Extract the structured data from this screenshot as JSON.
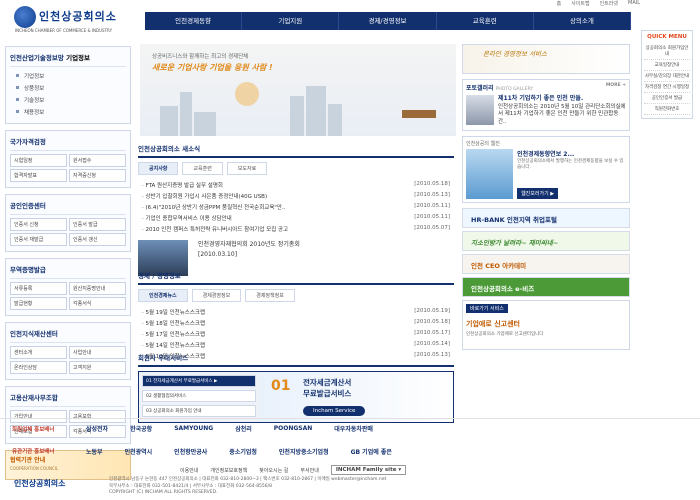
{
  "top_util": [
    "홈",
    "사이트맵",
    "인트라넷",
    "MAIL"
  ],
  "logo": {
    "name": "인천상공회의소",
    "eng": "INCHEON CHAMBER OF COMMERCE & INDUSTRY"
  },
  "gnb": [
    "인천경제동향",
    "기업지원",
    "경제/경영정보",
    "교육훈련",
    "상의소개"
  ],
  "left": {
    "info": {
      "title": "인천산업기술정보망",
      "bold": "기업정보",
      "items": [
        "기업정보",
        "상품정보",
        "기술정보",
        "채용정보"
      ]
    },
    "certificate": {
      "title": "국가자격검정",
      "items": [
        "시험일정",
        "원서접수",
        "합격자발표",
        "자격증신청"
      ]
    },
    "cert_issue": {
      "title": "공인인증센터",
      "items": [
        "인증서 신청",
        "인증서 발급",
        "인증서 재발급",
        "인증서 갱신"
      ]
    },
    "trade": {
      "title": "무역증명발급",
      "items": [
        "서류등록",
        "원산지증명안내",
        "발급현황",
        "각종서식"
      ]
    },
    "ip": {
      "title": "인천지식재산센터",
      "items": [
        "센터소개",
        "사업안내",
        "온라인상담",
        "고객지원"
      ]
    },
    "arbitration": {
      "title": "고용산재사무조합",
      "items": [
        "가입안내",
        "고용보험",
        "산재보험",
        "각종서식"
      ]
    },
    "banner": {
      "main": "협력기관 안내",
      "sub": "COOPERATION COUNCIL"
    }
  },
  "hero": {
    "t1": "상공비즈니스와 함께하는 최고의 경제단체",
    "t2": "새로운 기업사랑 기업을 응원 사람 !"
  },
  "news": {
    "title": "인천상공회의소 새소식",
    "tabs": [
      "공지사항",
      "교육훈련",
      "보도자료"
    ],
    "rows": [
      {
        "title": "FTA 원산지증명 발급 실무 설명회",
        "date": "[2010.05.18]"
      },
      {
        "title": "상반기 입찰회원 가입시 사은품 증정안내(40G USB)",
        "date": "[2010.05.13]"
      },
      {
        "title": "(6.4)\"2010년 상반기 성금PPM 품질혁신 전국순회교육\"안..",
        "date": "[2010.05.11]"
      },
      {
        "title": "기업인 종합무역서비스 이용 상담안내",
        "date": "[2010.05.11]"
      },
      {
        "title": "2010 인천 캠퍼스 특허전략 유니버시아드 참여기업 모집 공고",
        "date": "[2010.05.07]"
      }
    ],
    "photo_title": "인천경영자재협의회 2010년도 정기총회",
    "photo_date": "[2010.03.10]"
  },
  "econ": {
    "title": "경제 / 경영정보",
    "tabs": [
      "인천경제뉴스",
      "경제경영정보",
      "경제정책정보"
    ],
    "rows": [
      {
        "title": "5월 19일 인천뉴스스크랩",
        "date": "[2010.05.19]"
      },
      {
        "title": "5월 18일 인천뉴스스크랩",
        "date": "[2010.05.18]"
      },
      {
        "title": "5월 17일 인천뉴스스크랩",
        "date": "[2010.05.17]"
      },
      {
        "title": "5월 14일 인천뉴스스크랩",
        "date": "[2010.05.14]"
      },
      {
        "title": "5월 13일 인천뉴스스크랩",
        "date": "[2010.05.13]"
      }
    ]
  },
  "service": {
    "title": "회원사 부대서비스",
    "list": [
      "01 전자세금계산서 무료발급서비스 ▶",
      "02 생활협업의서비스",
      "03 상공회의소 회원가입 안내"
    ],
    "num": "01",
    "line1": "전자세금계산서",
    "line2": "무료발급서비스",
    "btn": "Incham Service"
  },
  "right": {
    "banner1": "온라인 경영정보 서비스",
    "gallery": {
      "title": "포토갤러리",
      "sub": "PHOTO GALLERY",
      "more": "MORE +",
      "headline": "제11차 기업하기 좋은 인천 만들.",
      "desc": "인천상공회의소는 2010년 5월 10일 관리단소회의실에서 제11차 기업하기 좋은 인천 만들기 위한 민관합동간.."
    },
    "book": {
      "section": "인천상공의 웹진",
      "title": "인천경제동향연보 2...",
      "desc": "인천상공회의소에서 발행하는 인천경제동향을 보실 수 있습니다.",
      "btn": "웹진보러가기 ▶"
    },
    "banners": [
      "HR-BANK 인천지역 취업포털",
      "지소인방가 날려라~ 재미씨네~",
      "인천 CEO 아카데미",
      "인천상공회의소 e-비즈"
    ],
    "complaint": {
      "head": "바로가기 서비스",
      "main": "기업애로 신고센터",
      "sub": "인천상공회의소 기업애로 신고센터입니다"
    }
  },
  "quick": {
    "title": "QUICK MENU",
    "items": [
      "상공회의소 회원가입안내",
      "교육일정안내",
      "사무실/강의장 대관안내",
      "자격검정 연간 시행일정",
      "공인인증서 발급",
      "직원전화번호"
    ]
  },
  "partners1": {
    "label": "회원업체 홍보배너",
    "logos": [
      "삼성전자",
      "한국공항",
      "SAMYOUNG",
      "삼천리",
      "POONGSAN",
      "대우자동차판매"
    ]
  },
  "partners2": {
    "label": "유관기관 홍보배너",
    "logos": [
      "노동부",
      "인천광역시",
      "인천항만공사",
      "중소기업청",
      "인천지방중소기업청",
      "GB 기업에 좋은"
    ]
  },
  "footnav": [
    "이용안내",
    "개인정보보호정책",
    "찾아오시는 길",
    "부서안내"
  ],
  "family_site": "INCHAM Family site",
  "footer": {
    "logo": "인천상공회의소",
    "line1": "인천광역시 남동구 논현동 447 인천상공회의소 | 대표전화 032-810-2800~3 | 팩스번호 032-810-2867 | 이메일 webmaster@incham.net",
    "line2": "북부사무소 : 대표전화 032-501-8421/4 | 서부사무소 : 대표전화 032-564-8556/8",
    "line3": "COPYRIGHT (C) INCHAM ALL RIGHTS RESERVED."
  }
}
